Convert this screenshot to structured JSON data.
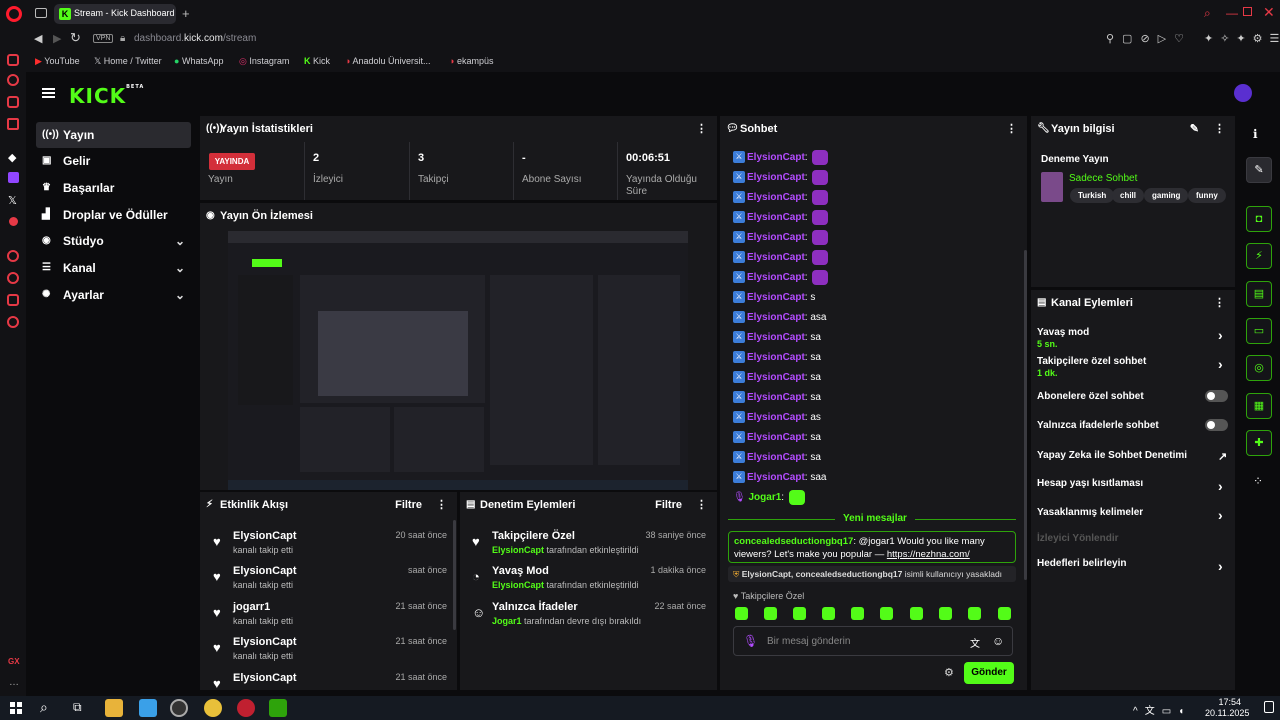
{
  "browser": {
    "tab_title": "Stream - Kick Dashboard",
    "url_prefix": "dashboard.",
    "url_domain": "kick.com",
    "url_path": "/stream",
    "vpn": "VPN",
    "bookmarks": [
      "YouTube",
      "Home / Twitter",
      "WhatsApp",
      "Instagram",
      "Kick",
      "Anadolu Üniversit...",
      "ekampüs"
    ]
  },
  "logo": {
    "text": "KICK",
    "beta": "BETA"
  },
  "nav": [
    {
      "label": "Yayın",
      "icon": "broadcast-icon"
    },
    {
      "label": "Gelir",
      "icon": "money-icon"
    },
    {
      "label": "Başarılar",
      "icon": "trophy-icon"
    },
    {
      "label": "Droplar ve Ödüller",
      "icon": "gift-icon"
    },
    {
      "label": "Stüdyo",
      "icon": "studio-icon"
    },
    {
      "label": "Kanal",
      "icon": "list-icon"
    },
    {
      "label": "Ayarlar",
      "icon": "settings-icon"
    }
  ],
  "stats": {
    "title": "Yayın İstatistikleri",
    "live": "YAYINDA",
    "live_label": "Yayın",
    "items": [
      {
        "value": "2",
        "label": "İzleyici"
      },
      {
        "value": "3",
        "label": "Takipçi"
      },
      {
        "value": "-",
        "label": "Abone Sayısı"
      },
      {
        "value": "00:06:51",
        "label": "Yayında Olduğu Süre"
      }
    ]
  },
  "preview": {
    "title": "Yayın Ön İzlemesi"
  },
  "activity": {
    "title": "Etkinlik Akışı",
    "filter": "Filtre",
    "items": [
      {
        "name": "ElysionCapt",
        "sub": "kanalı takip etti",
        "time": "20 saat önce"
      },
      {
        "name": "ElysionCapt",
        "sub": "kanalı takip etti",
        "time": "saat önce"
      },
      {
        "name": "jogarr1",
        "sub": "kanalı takip etti",
        "time": "21 saat önce"
      },
      {
        "name": "ElysionCapt",
        "sub": "kanalı takip etti",
        "time": "21 saat önce"
      },
      {
        "name": "ElysionCapt",
        "sub": "",
        "time": "21 saat önce"
      }
    ]
  },
  "moderation": {
    "title": "Denetim Eylemleri",
    "filter": "Filtre",
    "items": [
      {
        "name": "Takipçilere Özel",
        "user": "ElysionCapt",
        "sub": " tarafından etkinleştirildi",
        "time": "38 saniye önce"
      },
      {
        "name": "Yavaş Mod",
        "user": "ElysionCapt",
        "sub": " tarafından etkinleştirildi",
        "time": "1 dakika önce"
      },
      {
        "name": "Yalnızca İfadeler",
        "user": "Jogar1",
        "sub": " tarafından devre dışı bırakıldı",
        "time": "22 saat önce"
      }
    ]
  },
  "chat": {
    "title": "Sohbet",
    "messages": [
      {
        "user": "ElysionCapt",
        "text": "",
        "emote": true
      },
      {
        "user": "ElysionCapt",
        "text": "",
        "emote": true
      },
      {
        "user": "ElysionCapt",
        "text": "",
        "emote": true
      },
      {
        "user": "ElysionCapt",
        "text": "",
        "emote": true
      },
      {
        "user": "ElysionCapt",
        "text": "",
        "emote": true
      },
      {
        "user": "ElysionCapt",
        "text": "",
        "emote": true
      },
      {
        "user": "ElysionCapt",
        "text": "",
        "emote": true
      },
      {
        "user": "ElysionCapt",
        "text": "s",
        "emote": false
      },
      {
        "user": "ElysionCapt",
        "text": "asa",
        "emote": false
      },
      {
        "user": "ElysionCapt",
        "text": "sa",
        "emote": false
      },
      {
        "user": "ElysionCapt",
        "text": "sa",
        "emote": false
      },
      {
        "user": "ElysionCapt",
        "text": "sa",
        "emote": false
      },
      {
        "user": "ElysionCapt",
        "text": "sa",
        "emote": false
      },
      {
        "user": "ElysionCapt",
        "text": "as",
        "emote": false
      },
      {
        "user": "ElysionCapt",
        "text": "sa",
        "emote": false
      },
      {
        "user": "ElysionCapt",
        "text": "sa",
        "emote": false
      },
      {
        "user": "ElysionCapt",
        "text": "saa",
        "emote": false
      }
    ],
    "last_user": "Jogar1",
    "new_messages": "Yeni mesajlar",
    "spam": {
      "user": "concealedseductiongbq17",
      "text": ": @jogar1 Would you like many viewers? Let's make you popular — ",
      "link": "https://nezhna.com/"
    },
    "ban_notice": {
      "users": "ElysionCapt, concealedseductiongbq17",
      "text": " isimli kullanıcıyı yasakladı"
    },
    "followers_only": "Takipçilere Özel",
    "placeholder": "Bir mesaj gönderin",
    "send": "Gönder"
  },
  "info": {
    "title": "Yayın bilgisi",
    "stream_title": "Deneme Yayın",
    "category": "Sadece Sohbet",
    "tags": [
      "Turkish",
      "chill",
      "gaming",
      "funny"
    ]
  },
  "channel_actions": {
    "title": "Kanal Eylemleri",
    "items": [
      {
        "label": "Yavaş mod",
        "sub": "5 sn."
      },
      {
        "label": "Takipçilere özel sohbet",
        "sub": "1 dk."
      },
      {
        "label": "Abonelere özel sohbet",
        "sub": ""
      },
      {
        "label": "Yalnızca ifadelerle sohbet",
        "sub": ""
      },
      {
        "label": "Yapay Zeka ile Sohbet Denetimi",
        "sub": ""
      },
      {
        "label": "Hesap yaşı kısıtlaması",
        "sub": ""
      },
      {
        "label": "Yasaklanmış kelimeler",
        "sub": ""
      },
      {
        "label": "İzleyici Yönlendir",
        "sub": ""
      },
      {
        "label": "Hedefleri belirleyin",
        "sub": ""
      }
    ]
  },
  "taskbar": {
    "time": "17:54",
    "date": "20.11.2025"
  },
  "colors": {
    "accent": "#53fc18",
    "live": "#d32f3a",
    "username": "#b34cff"
  }
}
